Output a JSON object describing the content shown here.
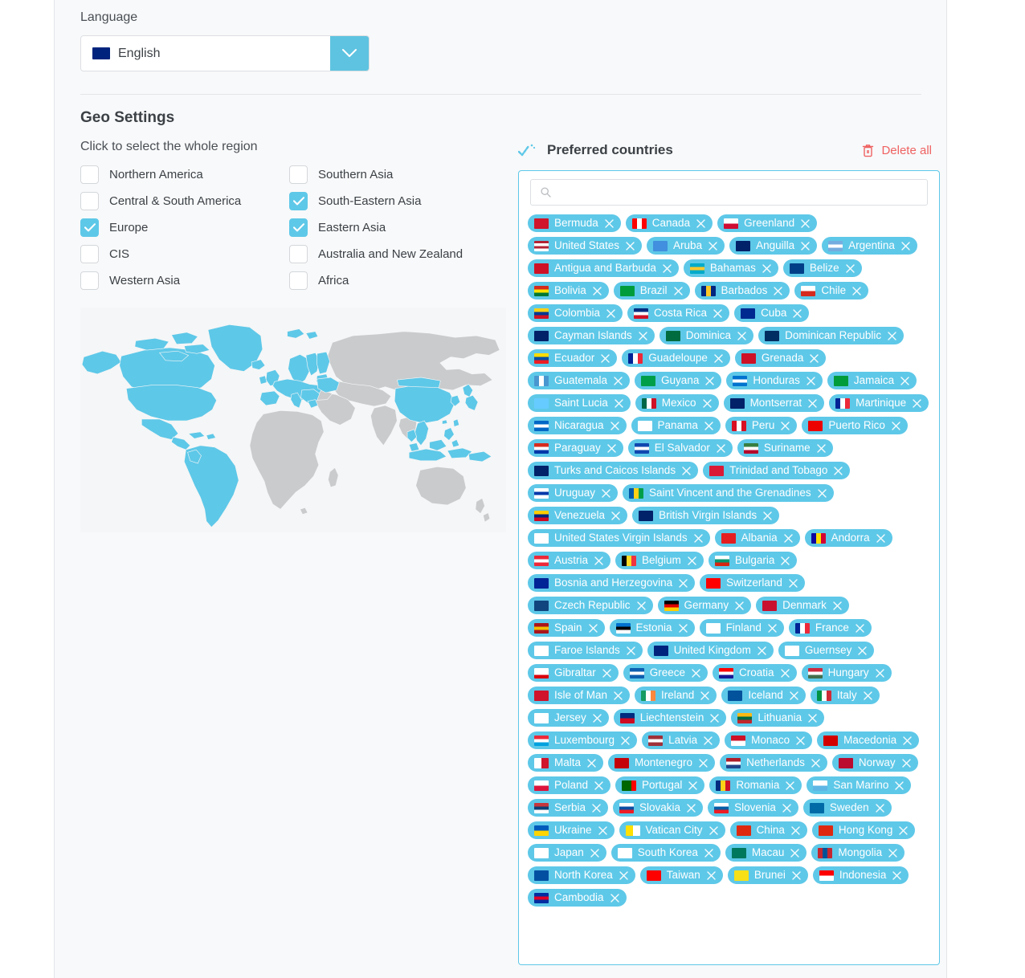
{
  "colors": {
    "accent": "#5ec8e8",
    "accent_dark": "#5ec3e0",
    "danger": "#ef6262",
    "text": "#3c4146",
    "panel_bg": "#f8f9fa",
    "map_land": "#c9cbcd",
    "map_selected": "#5ec8e8"
  },
  "language": {
    "label": "Language",
    "selected": "English",
    "flag": "gb",
    "dropdown_icon": "chevron-down-icon"
  },
  "geo": {
    "title": "Geo Settings",
    "hint": "Click to select the whole region",
    "regions": [
      {
        "label": "Northern America",
        "checked": false
      },
      {
        "label": "Southern Asia",
        "checked": false
      },
      {
        "label": "Central & South America",
        "checked": false
      },
      {
        "label": "South-Eastern Asia",
        "checked": true
      },
      {
        "label": "Europe",
        "checked": true
      },
      {
        "label": "Eastern Asia",
        "checked": true
      },
      {
        "label": "CIS",
        "checked": false
      },
      {
        "label": "Australia and New Zealand",
        "checked": false
      },
      {
        "label": "Western Asia",
        "checked": false
      },
      {
        "label": "Africa",
        "checked": false
      }
    ]
  },
  "preferred": {
    "icon": "check-trail-icon",
    "title": "Preferred countries",
    "delete_all_label": "Delete all",
    "delete_all_icon": "trash-icon",
    "search": {
      "placeholder": "",
      "value": "",
      "icon": "search-icon"
    },
    "remove_icon": "close-icon",
    "countries": [
      {
        "name": "Bermuda",
        "flag": "bm"
      },
      {
        "name": "Canada",
        "flag": "ca"
      },
      {
        "name": "Greenland",
        "flag": "gl"
      },
      {
        "name": "United States",
        "flag": "us"
      },
      {
        "name": "Aruba",
        "flag": "aw"
      },
      {
        "name": "Anguilla",
        "flag": "ai"
      },
      {
        "name": "Argentina",
        "flag": "ar"
      },
      {
        "name": "Antigua and Barbuda",
        "flag": "ag"
      },
      {
        "name": "Bahamas",
        "flag": "bs"
      },
      {
        "name": "Belize",
        "flag": "bz"
      },
      {
        "name": "Bolivia",
        "flag": "bo"
      },
      {
        "name": "Brazil",
        "flag": "br"
      },
      {
        "name": "Barbados",
        "flag": "bb"
      },
      {
        "name": "Chile",
        "flag": "cl"
      },
      {
        "name": "Colombia",
        "flag": "co"
      },
      {
        "name": "Costa Rica",
        "flag": "cr"
      },
      {
        "name": "Cuba",
        "flag": "cu"
      },
      {
        "name": "Cayman Islands",
        "flag": "ky"
      },
      {
        "name": "Dominica",
        "flag": "dm"
      },
      {
        "name": "Dominican Republic",
        "flag": "do"
      },
      {
        "name": "Ecuador",
        "flag": "ec"
      },
      {
        "name": "Guadeloupe",
        "flag": "gp"
      },
      {
        "name": "Grenada",
        "flag": "gd"
      },
      {
        "name": "Guatemala",
        "flag": "gt"
      },
      {
        "name": "Guyana",
        "flag": "gy"
      },
      {
        "name": "Honduras",
        "flag": "hn"
      },
      {
        "name": "Jamaica",
        "flag": "jm"
      },
      {
        "name": "Saint Lucia",
        "flag": "lc"
      },
      {
        "name": "Mexico",
        "flag": "mx"
      },
      {
        "name": "Montserrat",
        "flag": "ms"
      },
      {
        "name": "Martinique",
        "flag": "mq"
      },
      {
        "name": "Nicaragua",
        "flag": "ni"
      },
      {
        "name": "Panama",
        "flag": "pa"
      },
      {
        "name": "Peru",
        "flag": "pe"
      },
      {
        "name": "Puerto Rico",
        "flag": "pr"
      },
      {
        "name": "Paraguay",
        "flag": "py"
      },
      {
        "name": "El Salvador",
        "flag": "sv"
      },
      {
        "name": "Suriname",
        "flag": "sr"
      },
      {
        "name": "Turks and Caicos Islands",
        "flag": "tc"
      },
      {
        "name": "Trinidad and Tobago",
        "flag": "tt"
      },
      {
        "name": "Uruguay",
        "flag": "uy"
      },
      {
        "name": "Saint Vincent and the Grenadines",
        "flag": "vc"
      },
      {
        "name": "Venezuela",
        "flag": "ve"
      },
      {
        "name": "British Virgin Islands",
        "flag": "vg"
      },
      {
        "name": "United States Virgin Islands",
        "flag": "vi"
      },
      {
        "name": "Albania",
        "flag": "al"
      },
      {
        "name": "Andorra",
        "flag": "ad"
      },
      {
        "name": "Austria",
        "flag": "at"
      },
      {
        "name": "Belgium",
        "flag": "be"
      },
      {
        "name": "Bulgaria",
        "flag": "bg"
      },
      {
        "name": "Bosnia and Herzegovina",
        "flag": "ba"
      },
      {
        "name": "Switzerland",
        "flag": "ch"
      },
      {
        "name": "Czech Republic",
        "flag": "cz"
      },
      {
        "name": "Germany",
        "flag": "de"
      },
      {
        "name": "Denmark",
        "flag": "dk"
      },
      {
        "name": "Spain",
        "flag": "es"
      },
      {
        "name": "Estonia",
        "flag": "ee"
      },
      {
        "name": "Finland",
        "flag": "fi"
      },
      {
        "name": "France",
        "flag": "fr"
      },
      {
        "name": "Faroe Islands",
        "flag": "fo"
      },
      {
        "name": "United Kingdom",
        "flag": "gb"
      },
      {
        "name": "Guernsey",
        "flag": "gg"
      },
      {
        "name": "Gibraltar",
        "flag": "gi"
      },
      {
        "name": "Greece",
        "flag": "gr"
      },
      {
        "name": "Croatia",
        "flag": "hr"
      },
      {
        "name": "Hungary",
        "flag": "hu"
      },
      {
        "name": "Isle of Man",
        "flag": "im"
      },
      {
        "name": "Ireland",
        "flag": "ie"
      },
      {
        "name": "Iceland",
        "flag": "is"
      },
      {
        "name": "Italy",
        "flag": "it"
      },
      {
        "name": "Jersey",
        "flag": "je"
      },
      {
        "name": "Liechtenstein",
        "flag": "li"
      },
      {
        "name": "Lithuania",
        "flag": "lt"
      },
      {
        "name": "Luxembourg",
        "flag": "lu"
      },
      {
        "name": "Latvia",
        "flag": "lv"
      },
      {
        "name": "Monaco",
        "flag": "mc"
      },
      {
        "name": "Macedonia",
        "flag": "mk"
      },
      {
        "name": "Malta",
        "flag": "mt"
      },
      {
        "name": "Montenegro",
        "flag": "me"
      },
      {
        "name": "Netherlands",
        "flag": "nl"
      },
      {
        "name": "Norway",
        "flag": "no"
      },
      {
        "name": "Poland",
        "flag": "pl"
      },
      {
        "name": "Portugal",
        "flag": "pt"
      },
      {
        "name": "Romania",
        "flag": "ro"
      },
      {
        "name": "San Marino",
        "flag": "sm"
      },
      {
        "name": "Serbia",
        "flag": "rs"
      },
      {
        "name": "Slovakia",
        "flag": "sk"
      },
      {
        "name": "Slovenia",
        "flag": "si"
      },
      {
        "name": "Sweden",
        "flag": "se"
      },
      {
        "name": "Ukraine",
        "flag": "ua"
      },
      {
        "name": "Vatican City",
        "flag": "va"
      },
      {
        "name": "China",
        "flag": "cn"
      },
      {
        "name": "Hong Kong",
        "flag": "hk"
      },
      {
        "name": "Japan",
        "flag": "jp"
      },
      {
        "name": "South Korea",
        "flag": "kr"
      },
      {
        "name": "Macau",
        "flag": "mo"
      },
      {
        "name": "Mongolia",
        "flag": "mn"
      },
      {
        "name": "North Korea",
        "flag": "kp"
      },
      {
        "name": "Taiwan",
        "flag": "tw"
      },
      {
        "name": "Brunei",
        "flag": "bn"
      },
      {
        "name": "Indonesia",
        "flag": "id"
      },
      {
        "name": "Cambodia",
        "flag": "kh"
      }
    ]
  }
}
